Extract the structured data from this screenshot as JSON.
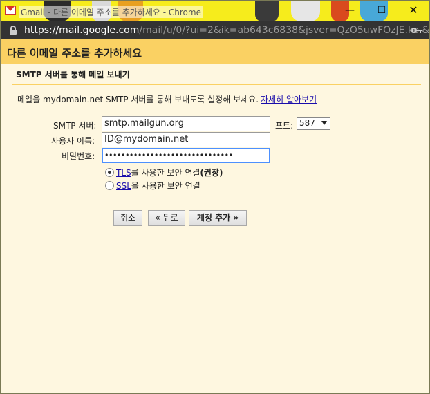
{
  "window": {
    "title": "Gmail - 다른 이메일 주소를 추가하세요 - Chrome",
    "buttons": {
      "minimize": "—",
      "maximize": "☐",
      "close": "✕"
    }
  },
  "address_bar": {
    "url_host": "https://mail.google.com",
    "url_path": "/mail/u/0/?ui=2&ik=ab643c6838&jsver=QzO5uwFOzJE.ko.&..."
  },
  "page": {
    "title": "다른 이메일 주소를 추가하세요",
    "section_title": "SMTP 서버를 통해 메일 보내기",
    "description": "메일을 mydomain.net SMTP 서버를 통해 보내도록 설정해 보세요.",
    "learn_more": "자세히 알아보기"
  },
  "form": {
    "smtp_server_label": "SMTP 서버:",
    "smtp_server_value": "smtp.mailgun.org",
    "port_label": "포트:",
    "port_value": "587",
    "username_label": "사용자 이름:",
    "username_value": "ID@mydomain.net",
    "password_label": "비밀번호:",
    "password_value": "•••••••••••••••••••••••••••••••",
    "tls_link": "TLS",
    "tls_text": "를 사용한 보안 연결",
    "tls_recommended": "(권장)",
    "ssl_link": "SSL",
    "ssl_text": "을 사용한 보안 연결",
    "security_selected": "TLS"
  },
  "buttons": {
    "cancel": "취소",
    "back": "« 뒤로",
    "add_account": "계정 추가 »"
  },
  "colors": {
    "header_bg": "#fad163",
    "content_bg": "#fef7e0",
    "link": "#1a0dab",
    "focus": "#4d90fe"
  }
}
